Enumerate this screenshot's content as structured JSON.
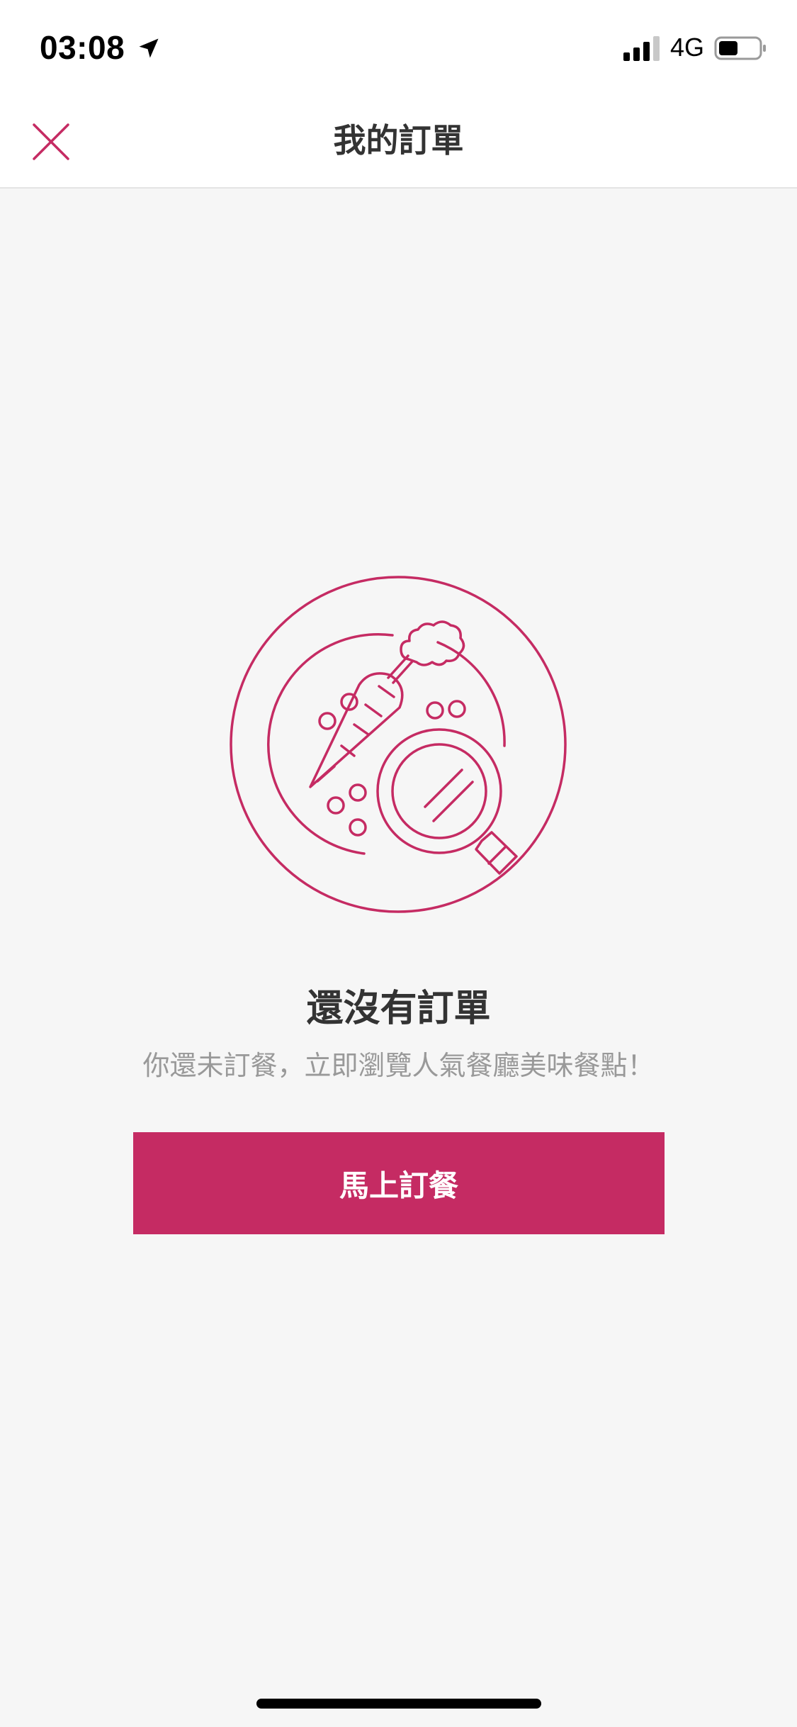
{
  "status_bar": {
    "time": "03:08",
    "network": "4G",
    "icons": [
      "location-arrow-icon",
      "cellular-signal-icon",
      "battery-icon"
    ]
  },
  "nav": {
    "title": "我的訂單",
    "close_icon": "close-icon"
  },
  "empty_state": {
    "illustration": "food-plate-search-icon",
    "title": "還沒有訂單",
    "subtitle": "你還未訂餐，立即瀏覽人氣餐廳美味餐點！",
    "button_label": "馬上訂餐"
  },
  "colors": {
    "accent": "#c52b63",
    "background": "#f6f6f6",
    "title_text": "#333333",
    "subtitle_text": "#999999"
  }
}
